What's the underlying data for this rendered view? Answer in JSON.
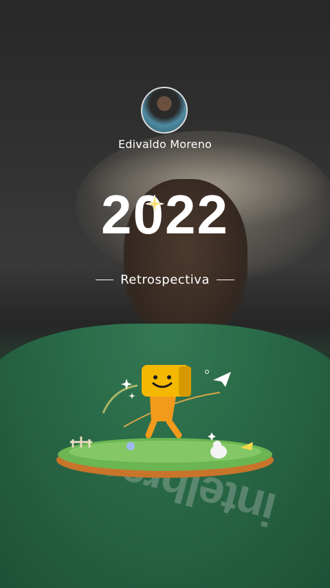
{
  "profile": {
    "name": "Edivaldo Moreno"
  },
  "recap": {
    "year": "2022",
    "subtitle": "Retrospectiva"
  },
  "background": {
    "shirt_text": "intelbras"
  },
  "icons": {
    "avatar": "user-avatar",
    "sparkle": "sparkle-icon",
    "paper_plane": "paper-plane-icon",
    "mascot": "smiley-box-character"
  },
  "colors": {
    "text": "#ffffff",
    "shirt_green": "#2f7a53",
    "mascot_yellow": "#f5b800",
    "grass": "#5ca64a"
  }
}
